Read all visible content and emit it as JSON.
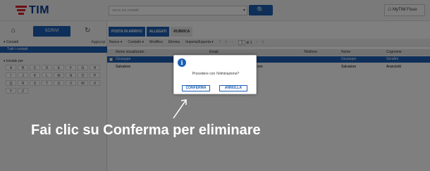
{
  "header": {
    "logo_text": "TIM",
    "search_placeholder": "cerca nei contatti",
    "search_dropdown_icon": "▾",
    "search_icon": "🔍",
    "mytim_label": "☖ MyTIM Fisso"
  },
  "sidebar": {
    "write_label": "SCRIVI",
    "contacts_label": "▾ Contatti",
    "add_label": "Aggiungi",
    "all_contacts_label": "Tutti i contatti",
    "initial_label": "▾ Iniziale per",
    "letters": [
      "A",
      "B",
      "C",
      "D",
      "E",
      "F",
      "G",
      "H",
      "I",
      "J",
      "K",
      "L",
      "M",
      "N",
      "O",
      "P",
      "Q",
      "R",
      "S",
      "T",
      "U",
      "V",
      "W",
      "X",
      "Y",
      "Z"
    ]
  },
  "tabs": [
    {
      "label": "POSTA IN ARRIVO"
    },
    {
      "label": "ALLEGATI"
    },
    {
      "label": "RUBRICA"
    }
  ],
  "toolbar": {
    "new_label": "Nuovo ▾",
    "contact_label": "Contatto ▾",
    "edit_label": "Modifica",
    "delete_label": "Elimina",
    "import_export_label": "Importa/Esporta ▾",
    "page_value": "1",
    "page_total": "di 1"
  },
  "table": {
    "headers": [
      "Nome visualizzato",
      "Email",
      "Telefono",
      "Nome",
      "Cognome"
    ],
    "rows": [
      {
        "name": "Giuseppe",
        "email": "",
        "phone": "",
        "first": "Giuseppe",
        "last": "Serafini",
        "selected": true
      },
      {
        "name": "Salvatore",
        "email": "...com",
        "phone": "",
        "first": "Salvatore",
        "last": "Aranciotti",
        "selected": false
      }
    ]
  },
  "dialog": {
    "message": "Procedere con l'eliminazione?",
    "confirm_label": "CONFERMA",
    "cancel_label": "ANNULLA"
  },
  "caption": "Fai clic su Conferma per eliminare",
  "colors": {
    "brand_blue": "#1d5fb3",
    "brand_red": "#d8202a"
  }
}
